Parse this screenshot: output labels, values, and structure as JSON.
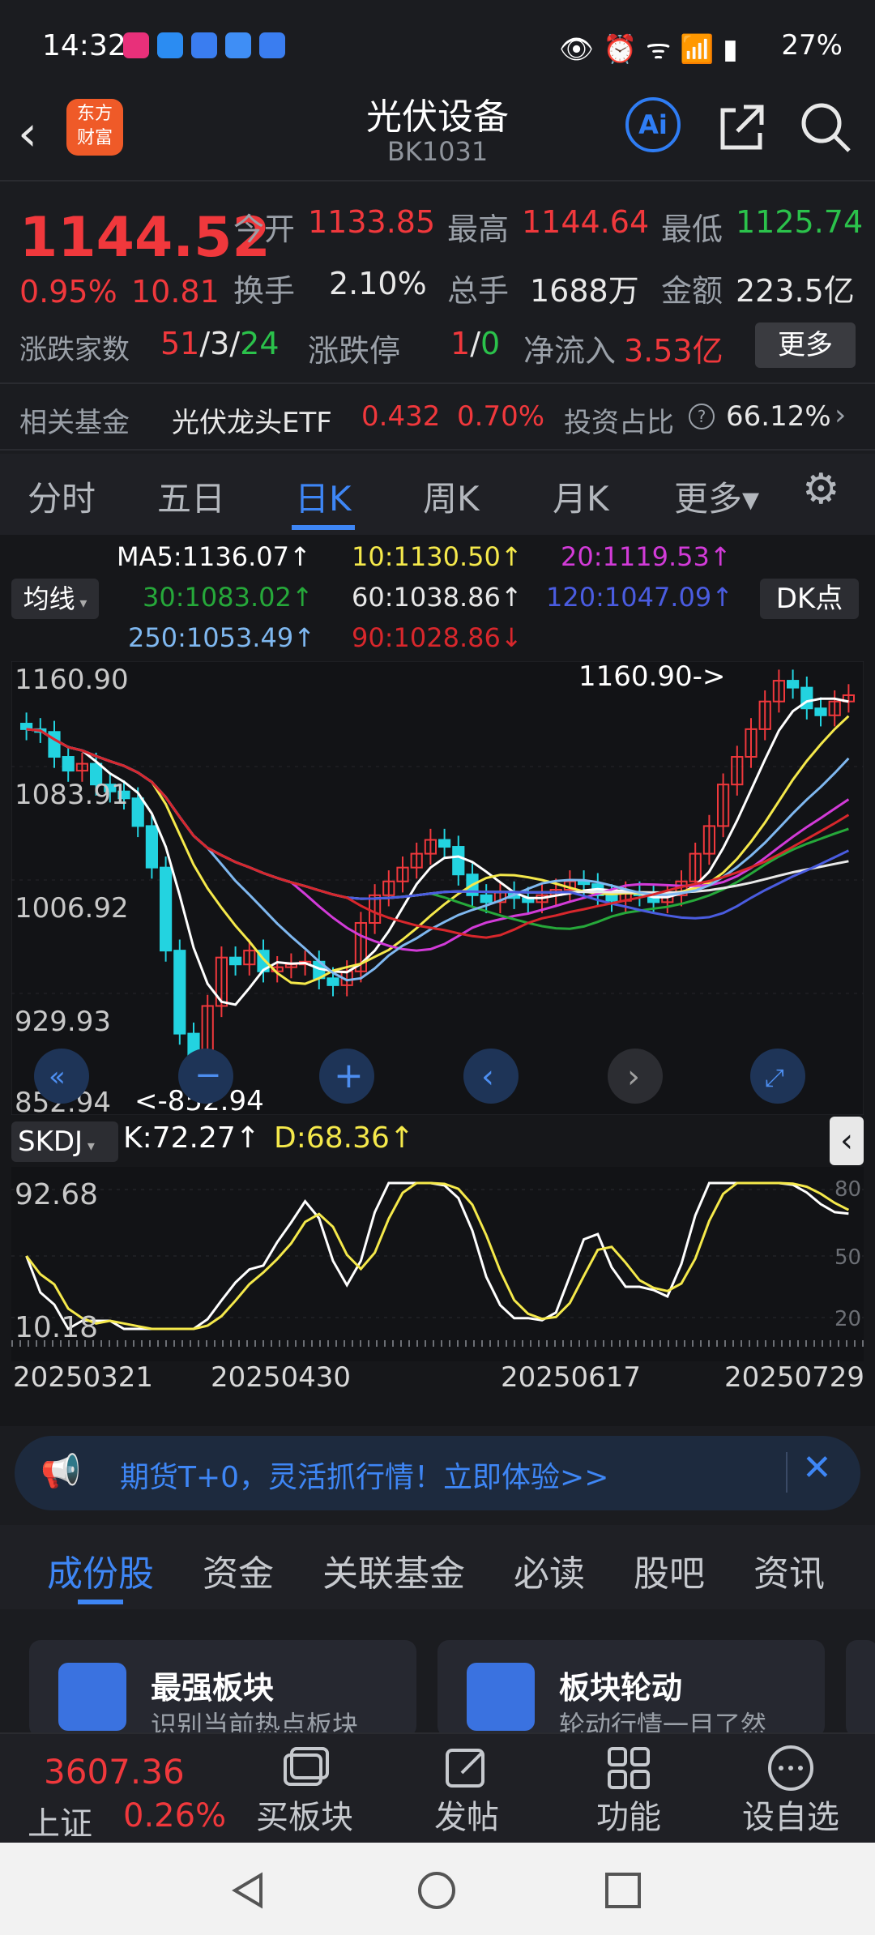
{
  "status": {
    "time": "14:32",
    "battery": "27%"
  },
  "header": {
    "title": "光伏设备",
    "code": "BK1031",
    "logo_line1": "东方",
    "logo_line2": "财富",
    "ai_label": "Ai"
  },
  "quote": {
    "price": "1144.52",
    "change_pct": "0.95%",
    "change": "10.81",
    "open_label": "今开",
    "open": "1133.85",
    "high_label": "最高",
    "high": "1144.64",
    "low_label": "最低",
    "low": "1125.74",
    "turnover_label": "换手",
    "turnover": "2.10%",
    "volume_label": "总手",
    "volume": "1688万",
    "amount_label": "金额",
    "amount": "223.5亿",
    "updown_label": "涨跌家数",
    "up": "51",
    "flat": "3",
    "down": "24",
    "limit_label": "涨跌停",
    "limit_up": "1",
    "limit_down": "0",
    "inflow_label": "净流入",
    "inflow": "3.53亿",
    "more": "更多"
  },
  "fund": {
    "label": "相关基金",
    "name": "光伏龙头ETF",
    "price": "0.432",
    "pct": "0.70%",
    "ratio_label": "投资占比",
    "ratio": "66.12%"
  },
  "period_tabs": [
    "分时",
    "五日",
    "日K",
    "周K",
    "月K",
    "更多▾"
  ],
  "ma": {
    "btn": "均线",
    "dk": "DK点",
    "ma5": "MA5:1136.07↑",
    "ma10": "10:1130.50↑",
    "ma20": "20:1119.53↑",
    "ma30": "30:1083.02↑",
    "ma60": "60:1038.86↑",
    "ma120": "120:1047.09↑",
    "ma250": "250:1053.49↑",
    "ma90": "90:1028.86↓"
  },
  "colors": {
    "ma5": "#ffffff",
    "ma10": "#f5e94b",
    "ma20": "#d23bd8",
    "ma30": "#26a83a",
    "ma60": "#e8e8e8",
    "ma120": "#4a5ce0",
    "ma250": "#7fb8f0",
    "ma90": "#d8272c",
    "up": "#f0383c",
    "down": "#23d3e0"
  },
  "kline": {
    "y_labels": [
      "1160.90",
      "1083.91",
      "1006.92",
      "929.93",
      "852.94"
    ],
    "max_note": "1160.90->",
    "min_note": "<-852.94"
  },
  "chart_data": {
    "type": "line",
    "title": "光伏设备 BK1031 日K",
    "x_ticks": [
      "20250321",
      "20250430",
      "20250617",
      "20250729"
    ],
    "price_range": [
      852.94,
      1160.9
    ],
    "ohlc_close_approx": [
      1120,
      1118,
      1100,
      1090,
      1095,
      1080,
      1075,
      1070,
      1050,
      1020,
      960,
      900,
      880,
      920,
      955,
      950,
      960,
      945,
      948,
      950,
      952,
      940,
      935,
      945,
      980,
      1000,
      1010,
      1020,
      1030,
      1040,
      1035,
      1015,
      1000,
      995,
      1002,
      998,
      995,
      1000,
      1004,
      1010,
      1008,
      1000,
      996,
      1002,
      1000,
      995,
      1000,
      1010,
      1030,
      1050,
      1080,
      1100,
      1120,
      1140,
      1155,
      1150,
      1135,
      1130,
      1140,
      1144.52
    ]
  },
  "skdj": {
    "name": "SKDJ",
    "k": "K:72.27↑",
    "d": "D:68.36↑",
    "y_top": "92.68",
    "y_bottom": "10.18",
    "lv80": "80",
    "lv50": "50",
    "lv20": "20"
  },
  "promo": {
    "text": "期货T+0，灵活抓行情！立即体验>>"
  },
  "bottom_tabs": [
    "成份股",
    "资金",
    "关联基金",
    "必读",
    "股吧",
    "资讯"
  ],
  "cards": [
    {
      "title": "最强板块",
      "sub": "识别当前热点板块"
    },
    {
      "title": "板块轮动",
      "sub": "轮动行情一目了然"
    }
  ],
  "nav": {
    "index_value": "3607.36",
    "index_name": "上证",
    "index_pct": "0.26%",
    "buy": "买板块",
    "post": "发帖",
    "func": "功能",
    "fav": "设自选"
  }
}
